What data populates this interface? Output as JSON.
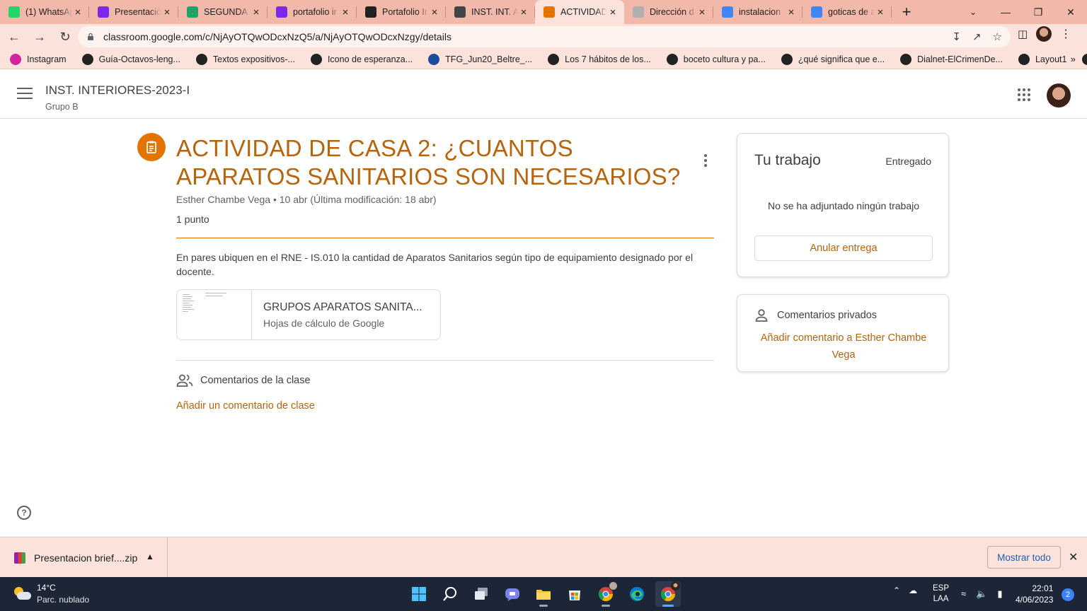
{
  "browser": {
    "tabs": [
      {
        "title": "(1) WhatsApp",
        "icon": "whatsapp-icon",
        "color": "#25d366",
        "active": false
      },
      {
        "title": "Presentación",
        "icon": "canva-icon",
        "color": "#7d2ae8",
        "active": false
      },
      {
        "title": "SEGUNDA T",
        "icon": "google-drive-icon",
        "color": "#1fa463",
        "active": false
      },
      {
        "title": "portafolio ir",
        "icon": "canva-icon",
        "color": "#7d2ae8",
        "active": false
      },
      {
        "title": "Portafolio Ir",
        "icon": "issuu-icon",
        "color": "#222222",
        "active": false
      },
      {
        "title": "INST. INT. A",
        "icon": "globe-icon",
        "color": "#444444",
        "active": false
      },
      {
        "title": "ACTIVIDAD",
        "icon": "classroom-icon",
        "color": "#e37400",
        "active": true
      },
      {
        "title": "Dirección d",
        "icon": "document-icon",
        "color": "#b0b0b0",
        "active": false
      },
      {
        "title": "instalacion",
        "icon": "google-icon",
        "color": "#4285f4",
        "active": false
      },
      {
        "title": "goticas de a",
        "icon": "google-icon",
        "color": "#4285f4",
        "active": false
      }
    ],
    "url": "classroom.google.com/c/NjAyOTQwODcxNzQ5/a/NjAyOTQwODcxNzgy/details",
    "bookmarks": [
      {
        "label": "Instagram",
        "icon": "instagram-icon",
        "color": "#d6249f"
      },
      {
        "label": "Guía-Octavos-leng...",
        "icon": "globe-icon",
        "color": "#222222"
      },
      {
        "label": "Textos expositivos-...",
        "icon": "globe-icon",
        "color": "#222222"
      },
      {
        "label": "Icono de esperanza...",
        "icon": "globe-icon",
        "color": "#222222"
      },
      {
        "label": "TFG_Jun20_Beltre_...",
        "icon": "repository-icon",
        "color": "#1a4c9a"
      },
      {
        "label": "Los 7 hábitos de los...",
        "icon": "globe-icon",
        "color": "#222222"
      },
      {
        "label": "boceto cultura y pa...",
        "icon": "globe-icon",
        "color": "#222222"
      },
      {
        "label": "¿qué significa que e...",
        "icon": "a-icon",
        "color": "#222222"
      },
      {
        "label": "Dialnet-ElCrimenDe...",
        "icon": "globe-icon",
        "color": "#222222"
      },
      {
        "label": "Layout1",
        "icon": "globe-icon",
        "color": "#222222"
      },
      {
        "label": "Layout1",
        "icon": "globe-icon",
        "color": "#222222"
      }
    ]
  },
  "course": {
    "name": "INST. INTERIORES-2023-I",
    "group": "Grupo B"
  },
  "assignment": {
    "title": "ACTIVIDAD DE CASA 2: ¿CUANTOS APARATOS SANITARIOS SON NECESARIOS?",
    "meta": "Esther Chambe Vega • 10 abr (Última modificación: 18 abr)",
    "points": "1 punto",
    "description": "En pares ubiquen en el RNE - IS.010 la cantidad de Aparatos Sanitarios según tipo de equipamiento designado por el docente.",
    "attachment": {
      "name": "GRUPOS APARATOS SANITA...",
      "type": "Hojas de cálculo de Google"
    },
    "class_comments_label": "Comentarios de la clase",
    "add_class_comment": "Añadir un comentario de clase"
  },
  "your_work": {
    "heading": "Tu trabajo",
    "status": "Entregado",
    "no_work": "No se ha adjuntado ningún trabajo",
    "unsubmit": "Anular entrega"
  },
  "private_comments": {
    "heading": "Comentarios privados",
    "add": "Añadir comentario a Esther Chambe Vega"
  },
  "download_bar": {
    "file": "Presentacion brief....zip",
    "show_all": "Mostrar todo"
  },
  "taskbar": {
    "temp": "14°C",
    "weather": "Parc. nublado",
    "lang1": "ESP",
    "lang2": "LAA",
    "time": "22:01",
    "date": "4/06/2023",
    "notifications": "2"
  },
  "colors": {
    "accent": "#e37400",
    "accent_text": "#b7640c",
    "tabstrip": "#f2b8a9",
    "toolbar": "#fbe3dc",
    "taskbar": "#1c2636"
  }
}
